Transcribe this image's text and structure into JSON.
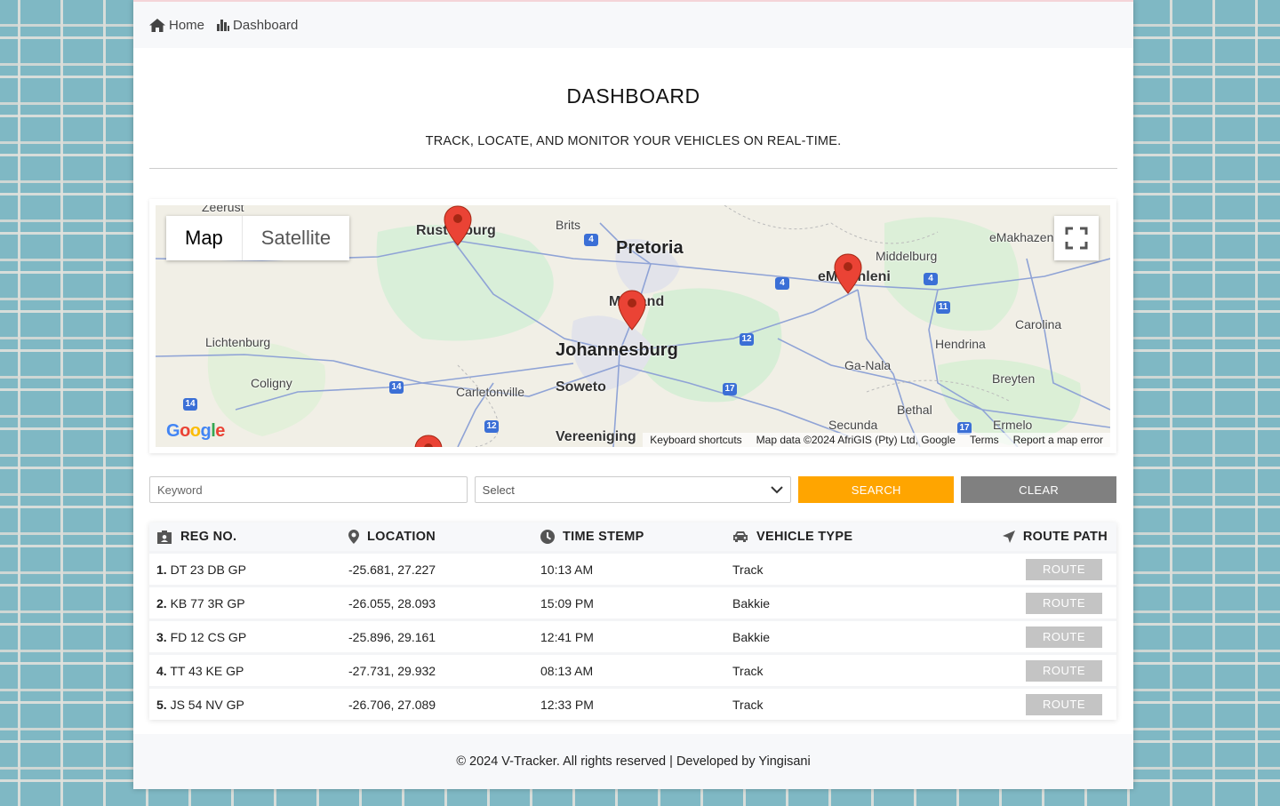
{
  "breadcrumb": {
    "home": "Home",
    "dashboard": "Dashboard"
  },
  "header": {
    "title": "DASHBOARD",
    "subtitle": "TRACK, LOCATE, AND MONITOR YOUR VEHICLES ON REAL-TIME."
  },
  "map": {
    "type_map": "Map",
    "type_satellite": "Satellite",
    "active_type": "Map",
    "places": {
      "zeerust": "Zeerust",
      "rustenburg": "Rustenburg",
      "brits": "Brits",
      "pretoria": "Pretoria",
      "middelburg": "Middelburg",
      "emakhazeni": "eMakhazeni",
      "emalahleni": "eMalahleni",
      "midrand": "Midrand",
      "lichtenburg": "Lichtenburg",
      "carolina": "Carolina",
      "hendrina": "Hendrina",
      "johannesburg": "Johannesburg",
      "coligny": "Coligny",
      "ganala": "Ga-Nala",
      "carletonville": "Carletonville",
      "soweto": "Soweto",
      "breyten": "Breyten",
      "bethal": "Bethal",
      "secunda": "Secunda",
      "ermelo": "Ermelo",
      "vereeniging": "Vereeniging"
    },
    "logo": "Google",
    "attribution": {
      "keyboard": "Keyboard shortcuts",
      "data": "Map data ©2024 AfriGIS (Pty) Ltd, Google",
      "terms": "Terms",
      "report": "Report a map error"
    },
    "marker_color": "#ea4335"
  },
  "filters": {
    "keyword_placeholder": "Keyword",
    "select_value": "Select",
    "search_label": "SEARCH",
    "clear_label": "CLEAR",
    "search_color": "#ffa500",
    "clear_color": "#808080"
  },
  "table": {
    "columns": [
      "REG NO.",
      "LOCATION",
      "TIME STEMP",
      "VEHICLE TYPE",
      "ROUTE PATH"
    ],
    "rows": [
      {
        "num": "1.",
        "reg": "DT 23 DB GP",
        "location": "-25.681, 27.227",
        "time": "10:13 AM",
        "type": "Track",
        "action": "ROUTE"
      },
      {
        "num": "2.",
        "reg": "KB 77 3R GP",
        "location": "-26.055, 28.093",
        "time": "15:09 PM",
        "type": "Bakkie",
        "action": "ROUTE"
      },
      {
        "num": "3.",
        "reg": "FD 12 CS GP",
        "location": "-25.896, 29.161",
        "time": "12:41 PM",
        "type": "Bakkie",
        "action": "ROUTE"
      },
      {
        "num": "4.",
        "reg": "TT 43 KE GP",
        "location": "-27.731, 29.932",
        "time": "08:13 AM",
        "type": "Track",
        "action": "ROUTE"
      },
      {
        "num": "5.",
        "reg": "JS 54 NV GP",
        "location": "-26.706, 27.089",
        "time": "12:33 PM",
        "type": "Track",
        "action": "ROUTE"
      }
    ]
  },
  "footer": {
    "text": "© 2024 V-Tracker. All rights reserved | Developed by Yingisani"
  }
}
